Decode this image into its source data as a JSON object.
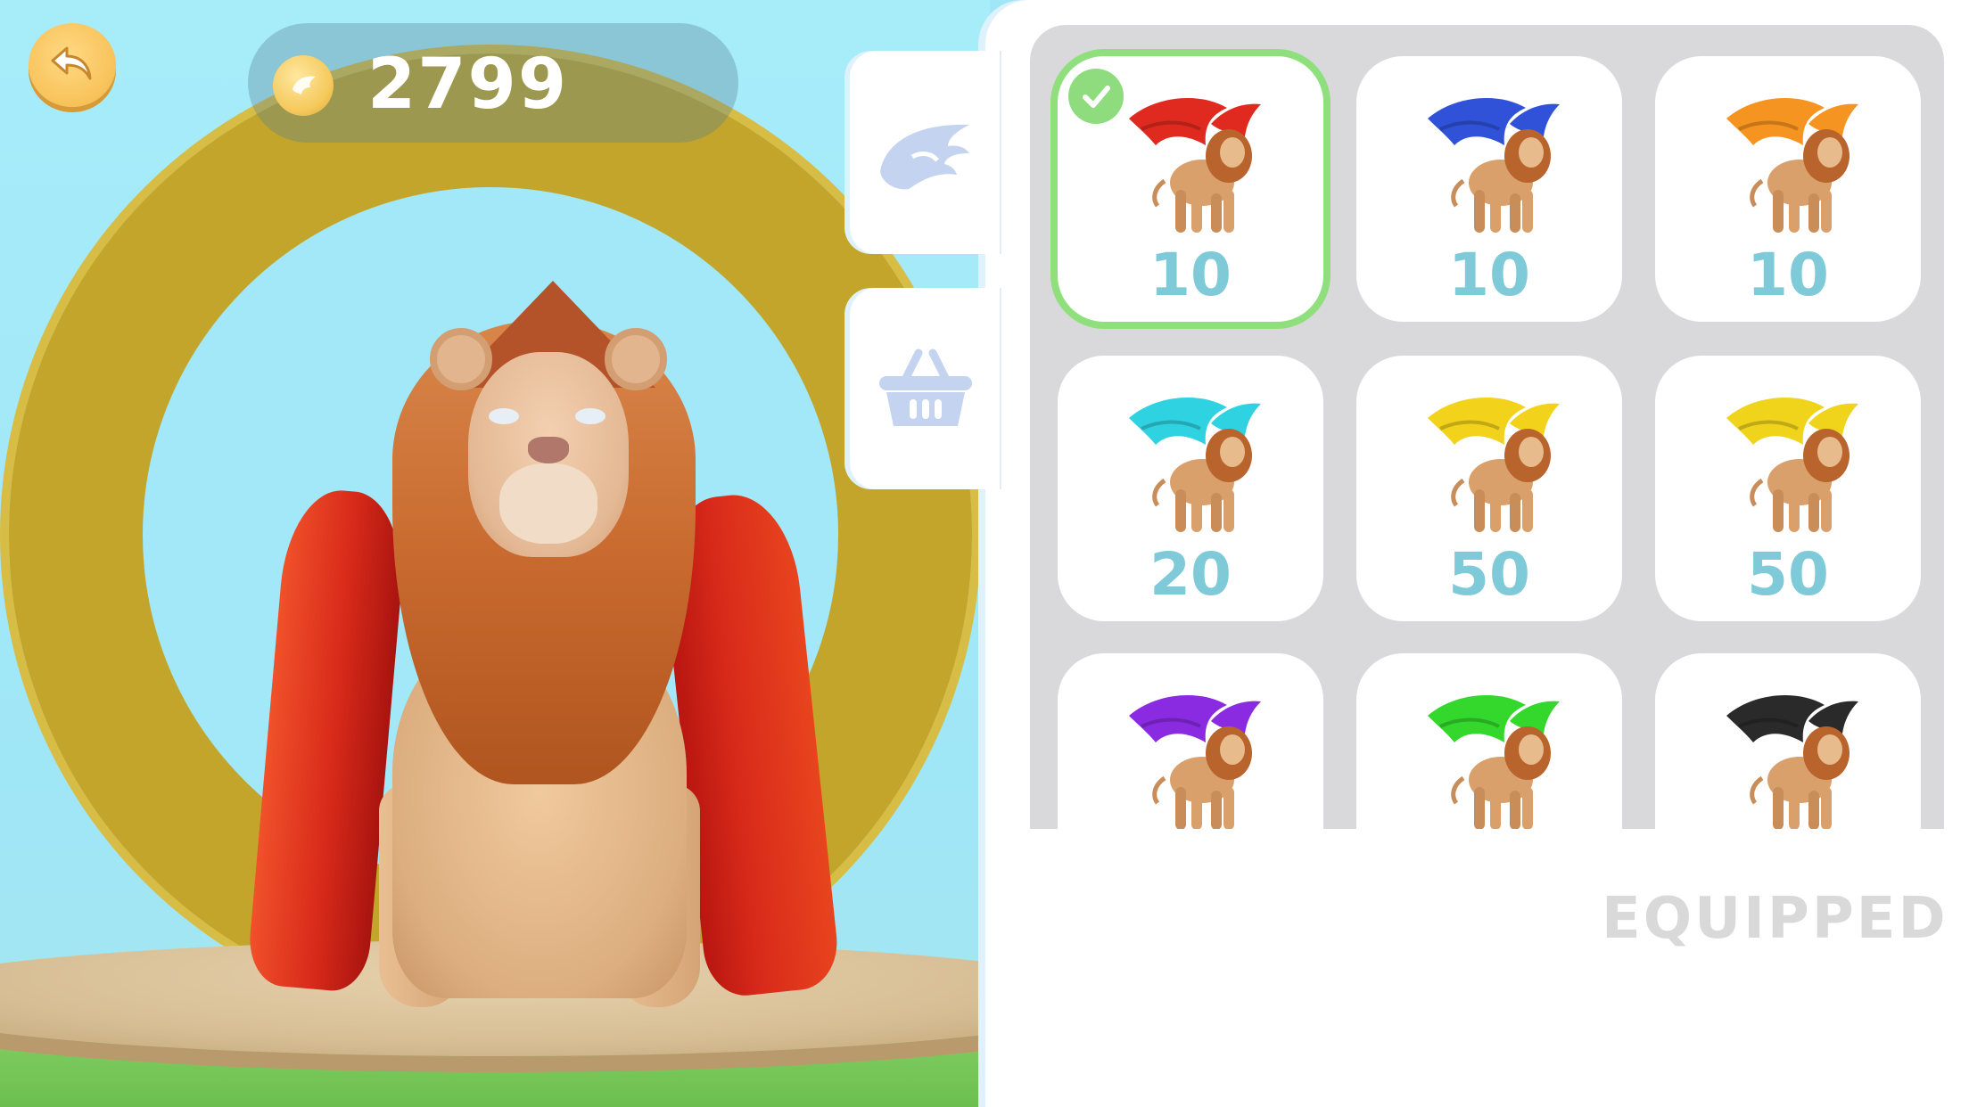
{
  "hud": {
    "back_icon": "back-arrow-icon",
    "coin_icon": "wing-coin-icon",
    "coins": "2799"
  },
  "tabs": [
    {
      "name": "tab-wings",
      "icon": "wing-icon",
      "active": true
    },
    {
      "name": "tab-shop",
      "icon": "basket-icon",
      "active": false
    }
  ],
  "items": [
    {
      "wing_color": "#e02a20",
      "price": "10",
      "equipped": true
    },
    {
      "wing_color": "#2f52d9",
      "price": "10",
      "equipped": false
    },
    {
      "wing_color": "#f59420",
      "price": "10",
      "equipped": false
    },
    {
      "wing_color": "#2fd2e0",
      "price": "20",
      "equipped": false
    },
    {
      "wing_color": "#f2d21a",
      "price": "50",
      "equipped": false
    },
    {
      "wing_color": "#f0d41c",
      "price": "50",
      "equipped": false
    },
    {
      "wing_color": "#8a2be2",
      "price": "",
      "equipped": false
    },
    {
      "wing_color": "#34d82c",
      "price": "",
      "equipped": false
    },
    {
      "wing_color": "#2a2a2a",
      "price": "",
      "equipped": false
    }
  ],
  "status_label": "EQUIPPED",
  "colors": {
    "price_text": "#7ecad8",
    "equipped_border": "#8fe07c",
    "gold_ring": "#c2a52a",
    "coin_gold": "#f5c85a"
  }
}
